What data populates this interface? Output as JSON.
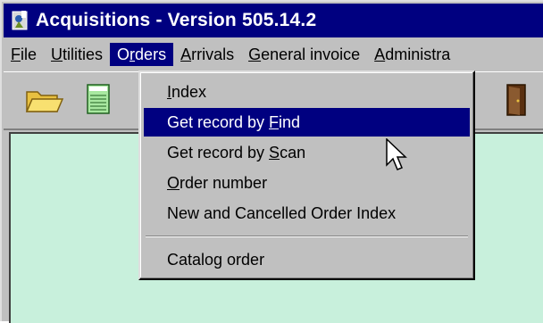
{
  "window": {
    "title": "Acquisitions - Version 505.14.2",
    "icon": "app-icon",
    "workspace_color": "#c8f0dc",
    "titlebar_color": "#000080"
  },
  "menubar": {
    "items": [
      {
        "pre": "",
        "mnemonic": "F",
        "post": "ile"
      },
      {
        "pre": "",
        "mnemonic": "U",
        "post": "tilities"
      },
      {
        "pre": "O",
        "mnemonic": "r",
        "post": "ders"
      },
      {
        "pre": "",
        "mnemonic": "A",
        "post": "rrivals"
      },
      {
        "pre": "",
        "mnemonic": "G",
        "post": "eneral invoice"
      },
      {
        "pre": "",
        "mnemonic": "A",
        "post": "dministra"
      }
    ]
  },
  "toolbar": {
    "buttons": [
      "folder-icon",
      "notepad-icon",
      "door-exit-icon"
    ]
  },
  "orders_menu": {
    "items": [
      {
        "pre": "",
        "mnemonic": "I",
        "post": "ndex"
      },
      {
        "pre": "Get record by ",
        "mnemonic": "F",
        "post": "ind"
      },
      {
        "pre": "Get record by ",
        "mnemonic": "S",
        "post": "can"
      },
      {
        "pre": "",
        "mnemonic": "O",
        "post": "rder number"
      },
      {
        "pre": "New and Cancelled Order Index",
        "mnemonic": "",
        "post": ""
      },
      {
        "pre": "Catalog order",
        "mnemonic": "",
        "post": ""
      }
    ],
    "highlighted_index": 1
  }
}
